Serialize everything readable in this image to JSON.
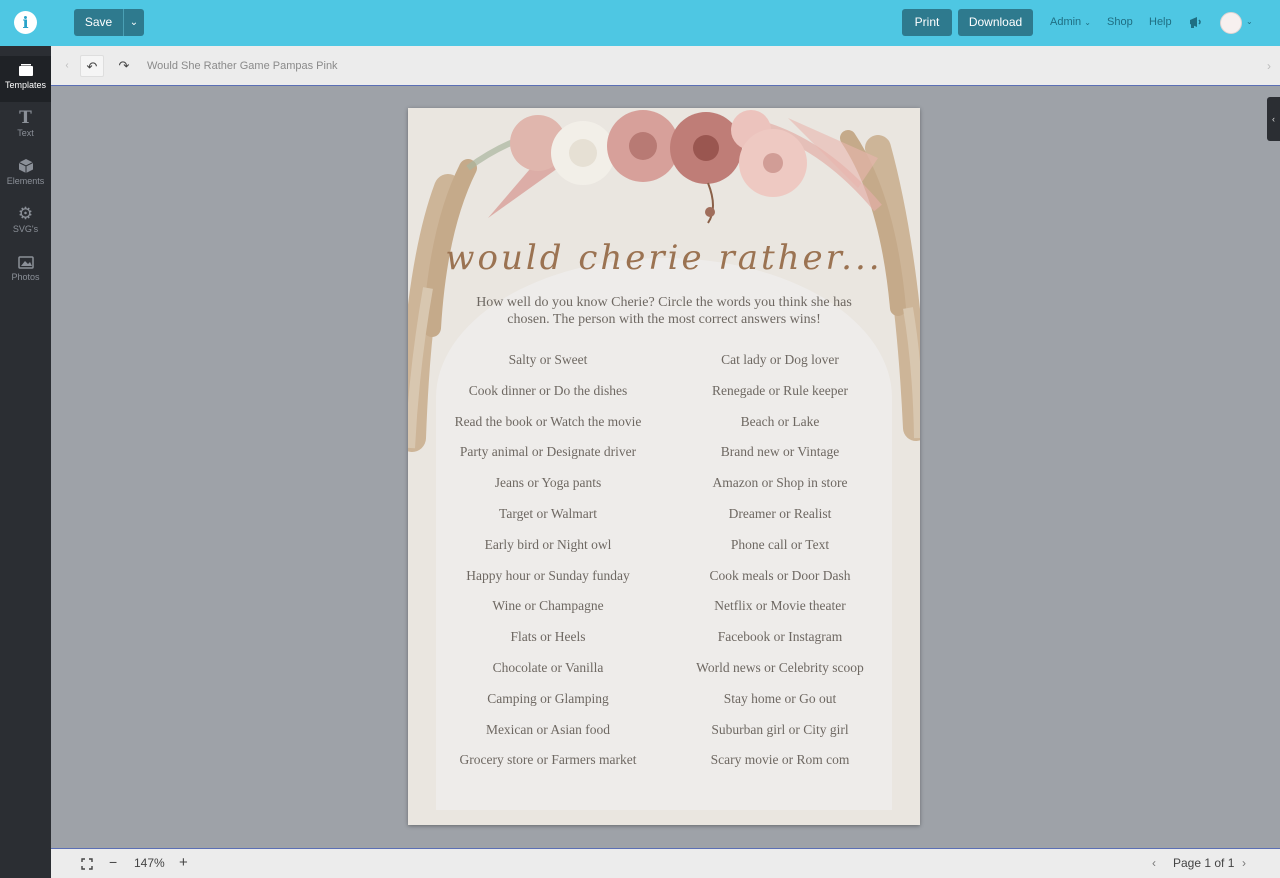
{
  "app": {
    "logo_letter": "i"
  },
  "topbar": {
    "save_label": "Save",
    "print_label": "Print",
    "download_label": "Download",
    "admin_label": "Admin",
    "shop_label": "Shop",
    "help_label": "Help",
    "accent_color": "#4ec7e3",
    "button_color": "#2e7a8e"
  },
  "sidebar": {
    "items": [
      {
        "label": "Templates",
        "icon": "templates-icon"
      },
      {
        "label": "Text",
        "icon": "text-icon"
      },
      {
        "label": "Elements",
        "icon": "elements-icon"
      },
      {
        "label": "SVG's",
        "icon": "gear-icon"
      },
      {
        "label": "Photos",
        "icon": "photos-icon"
      }
    ]
  },
  "toolbar": {
    "document_title": "Would She Rather Game Pampas Pink"
  },
  "design": {
    "heading": "would cherie rather...",
    "intro": "How well do you know Cherie?  Circle the words you think she has chosen. The person with the most correct answers wins!",
    "left_items": [
      "Salty or Sweet",
      "Cook dinner or Do the dishes",
      "Read the book or Watch the movie",
      "Party animal or Designate driver",
      "Jeans or Yoga pants",
      "Target or Walmart",
      "Early bird  or Night owl",
      "Happy hour or Sunday funday",
      "Wine or Champagne",
      "Flats or Heels",
      "Chocolate or Vanilla",
      "Camping  or Glamping",
      "Mexican or Asian food",
      "Grocery store or Farmers market"
    ],
    "right_items": [
      "Cat lady or Dog lover",
      "Renegade or Rule keeper",
      "Beach or Lake",
      "Brand new or Vintage",
      "Amazon or Shop in store",
      "Dreamer or Realist",
      "Phone call or Text",
      "Cook meals or Door Dash",
      "Netflix or Movie theater",
      "Facebook or Instagram",
      "World news or Celebrity scoop",
      "Stay home or Go out",
      "Suburban girl or City girl",
      "Scary movie or Rom com"
    ]
  },
  "bottombar": {
    "zoom_level": "147%",
    "page_label": "Page 1 of 1"
  }
}
